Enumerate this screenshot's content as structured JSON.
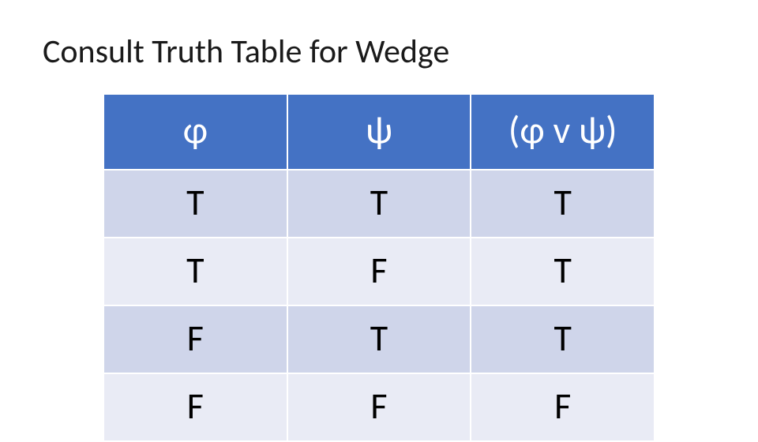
{
  "title": "Consult Truth Table for Wedge",
  "table": {
    "headers": [
      "φ",
      "ψ",
      "(φ v ψ)"
    ],
    "rows": [
      [
        "T",
        "T",
        "T"
      ],
      [
        "T",
        "F",
        "T"
      ],
      [
        "F",
        "T",
        "T"
      ],
      [
        "F",
        "F",
        "F"
      ]
    ]
  },
  "chart_data": {
    "type": "table",
    "title": "Consult Truth Table for Wedge",
    "columns": [
      "φ",
      "ψ",
      "(φ v ψ)"
    ],
    "rows": [
      {
        "φ": "T",
        "ψ": "T",
        "(φ v ψ)": "T"
      },
      {
        "φ": "T",
        "ψ": "F",
        "(φ v ψ)": "T"
      },
      {
        "φ": "F",
        "ψ": "T",
        "(φ v ψ)": "T"
      },
      {
        "φ": "F",
        "ψ": "F",
        "(φ v ψ)": "F"
      }
    ]
  },
  "colors": {
    "header_bg": "#4472C4",
    "row_odd_bg": "#CFD5EA",
    "row_even_bg": "#E9EBF5"
  }
}
